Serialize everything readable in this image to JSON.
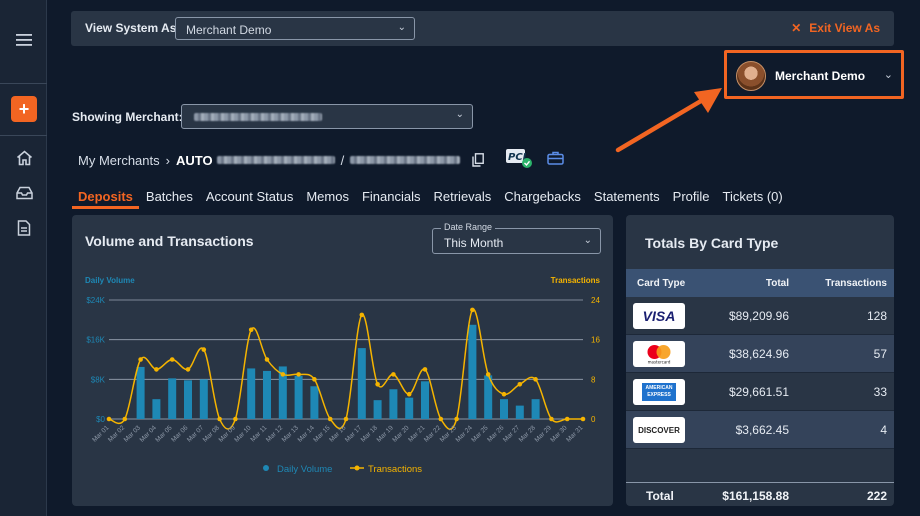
{
  "header": {
    "view_as_label": "View System As:",
    "view_as_value": "Merchant Demo",
    "exit_label": "Exit View As"
  },
  "user_menu": {
    "name": "Merchant Demo"
  },
  "merchant": {
    "showing_label": "Showing Merchant:"
  },
  "breadcrumb": {
    "root": "My Merchants",
    "merchant_prefix": "AUTO",
    "slash": "/"
  },
  "tabs": [
    "Deposits",
    "Batches",
    "Account Status",
    "Memos",
    "Financials",
    "Retrievals",
    "Chargebacks",
    "Statements",
    "Profile",
    "Tickets (0)"
  ],
  "chart_panel": {
    "title": "Volume and Transactions",
    "date_range_label": "Date Range",
    "date_range_value": "This Month"
  },
  "chart_data": {
    "type": "bar",
    "title": "",
    "categories": [
      "Mar 01",
      "Mar 02",
      "Mar 03",
      "Mar 04",
      "Mar 05",
      "Mar 06",
      "Mar 07",
      "Mar 08",
      "Mar 09",
      "Mar 10",
      "Mar 11",
      "Mar 12",
      "Mar 13",
      "Mar 14",
      "Mar 15",
      "Mar 16",
      "Mar 17",
      "Mar 18",
      "Mar 19",
      "Mar 20",
      "Mar 21",
      "Mar 22",
      "Mar 23",
      "Mar 24",
      "Mar 25",
      "Mar 26",
      "Mar 27",
      "Mar 28",
      "Mar 29",
      "Mar 30",
      "Mar 31"
    ],
    "series": [
      {
        "name": "Daily Volume",
        "axis": "left",
        "kind": "bar",
        "color": "#1e88b5",
        "values": [
          0,
          0,
          10500,
          4000,
          8200,
          7800,
          8000,
          0,
          0,
          10200,
          9700,
          10600,
          8700,
          6600,
          0,
          0,
          14300,
          3800,
          6000,
          4300,
          7600,
          0,
          0,
          19000,
          8800,
          4000,
          2700,
          4000,
          0,
          0,
          0
        ]
      },
      {
        "name": "Transactions",
        "axis": "right",
        "kind": "line",
        "color": "#f5b400",
        "values": [
          0,
          0,
          12,
          10,
          12,
          10,
          14,
          0,
          0,
          18,
          12,
          9,
          9,
          8,
          0,
          0,
          21,
          7,
          9,
          5,
          10,
          0,
          0,
          22,
          9,
          5,
          7,
          8,
          0,
          0,
          0
        ]
      }
    ],
    "ylabel_left": "Daily Volume",
    "ylabel_right": "Transactions",
    "y_left_ticks": [
      "$0",
      "$8K",
      "$16K",
      "$24K"
    ],
    "y_left_lim": [
      0,
      24000
    ],
    "y_right_ticks": [
      "0",
      "8",
      "16",
      "24"
    ],
    "y_right_lim": [
      0,
      24
    ],
    "grid": true,
    "legend": "bottom"
  },
  "totals": {
    "title": "Totals By Card Type",
    "columns": [
      "Card Type",
      "Total",
      "Transactions"
    ],
    "rows": [
      {
        "card": "VISA",
        "total": "$89,209.96",
        "transactions": "128"
      },
      {
        "card": "mastercard",
        "total": "$38,624.96",
        "transactions": "57"
      },
      {
        "card": "AMERICAN EXPRESS",
        "total": "$29,661.51",
        "transactions": "33"
      },
      {
        "card": "DISCOVER",
        "total": "$3,662.45",
        "transactions": "4"
      }
    ],
    "footer": {
      "label": "Total",
      "total": "$161,158.88",
      "transactions": "222"
    }
  },
  "colors": {
    "accent": "#f26522",
    "bar": "#1e88b5",
    "line": "#f5b400"
  }
}
